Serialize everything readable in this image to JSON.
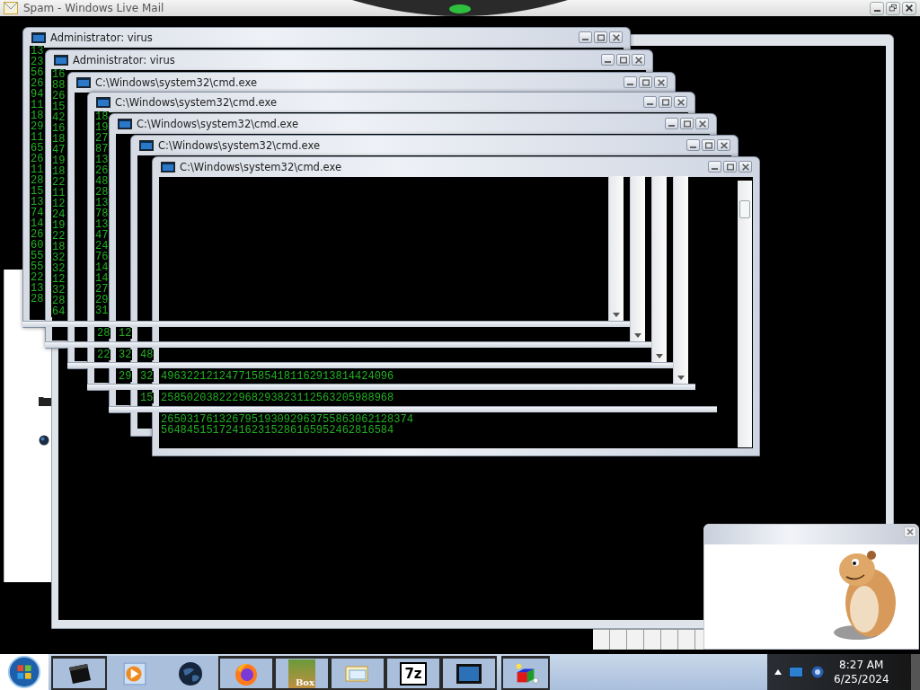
{
  "mail_window": {
    "title": "Spam - Windows Live Mail"
  },
  "console_windows": [
    {
      "title": "Administrator: virus",
      "lines": [
        "13",
        "23",
        "56",
        "26",
        "94",
        "11",
        "18",
        "29",
        "11",
        "65",
        "26",
        "11",
        "28",
        "15",
        "13",
        "74",
        "14",
        "26",
        "60",
        "55",
        "55",
        "22",
        "13",
        "28"
      ]
    },
    {
      "title": "Administrator: virus",
      "lines": [
        "16",
        "88",
        "26",
        "15",
        "42",
        "16",
        "18",
        "47",
        "19",
        "18",
        "22",
        "11",
        "12",
        "24",
        "19",
        "22",
        "18",
        "32",
        "32",
        "12",
        "32",
        "28",
        "64"
      ]
    },
    {
      "title": "C:\\Windows\\system32\\cmd.exe"
    },
    {
      "title": "C:\\Windows\\system32\\cmd.exe",
      "lines": [
        "18",
        "19",
        "27",
        "87",
        "13",
        "26",
        "48",
        "28",
        "13",
        "78",
        "13",
        "47",
        "24",
        "76",
        "14",
        "14",
        "27",
        "29",
        "31",
        "28",
        "22"
      ]
    },
    {
      "title": "C:\\Windows\\system32\\cmd.exe",
      "lines": [
        "12",
        "32",
        "29"
      ]
    },
    {
      "title": "C:\\Windows\\system32\\cmd.exe",
      "lines": [
        "48",
        "32",
        "15"
      ]
    },
    {
      "title": "C:\\Windows\\system32\\cmd.exe",
      "lines": [
        "496322121247715854181162913814424096",
        "258502038222968293823112563205988968",
        "265031761326795193092963755863062128374",
        "564845151724162315286165952462816584"
      ]
    }
  ],
  "taskbar": {
    "buttons": [
      {
        "kind": "terminal"
      },
      {
        "kind": "media"
      },
      {
        "kind": "globe"
      },
      {
        "kind": "browser"
      },
      {
        "kind": "game",
        "label": "Box"
      },
      {
        "kind": "mail"
      },
      {
        "kind": "archiver",
        "label": "7z"
      },
      {
        "kind": "console"
      },
      {
        "kind": "blocks"
      }
    ],
    "clock": {
      "time": "8:27 AM",
      "date": "6/25/2024"
    }
  }
}
